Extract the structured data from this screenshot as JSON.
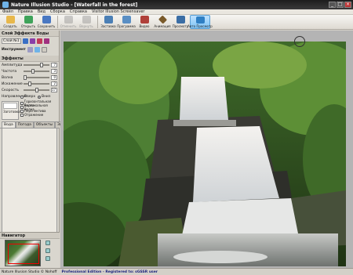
{
  "window": {
    "title": "Nature Illusion Studio - [Waterfall in the forest]"
  },
  "menu": [
    "Файл",
    "Правка",
    "Вид",
    "Сборка",
    "Справка",
    "Visitor Illusion Screensaver"
  ],
  "toolbar": {
    "buttons": [
      {
        "label": "Создать",
        "icon": "new-icon",
        "color": "#e8b84b",
        "state": "normal"
      },
      {
        "label": "Открыть",
        "icon": "open-icon",
        "color": "#3fa35a",
        "state": "normal"
      },
      {
        "label": "Сохранить",
        "icon": "save-icon",
        "color": "#4a78c2",
        "state": "normal"
      },
      {
        "label": "Отменить",
        "icon": "undo-icon",
        "color": "#777777",
        "state": "disabled"
      },
      {
        "label": "Вернуть",
        "icon": "redo-icon",
        "color": "#777777",
        "state": "disabled"
      },
      {
        "label": "Заставка",
        "icon": "screensaver-icon",
        "color": "#4b7fb5",
        "state": "normal"
      },
      {
        "label": "Программа",
        "icon": "program-icon",
        "color": "#5a8fc4",
        "state": "normal"
      },
      {
        "label": "Видео",
        "icon": "video-icon",
        "color": "#b0403a",
        "state": "normal"
      },
      {
        "label": "Анимация",
        "icon": "animation-icon",
        "color": "#7a5a2a",
        "state": "normal"
      },
      {
        "label": "Просмотр",
        "icon": "preview-icon",
        "color": "#3b6ea5",
        "state": "normal"
      },
      {
        "label": "Авто Просмотр",
        "icon": "auto-preview-icon",
        "color": "#2f7fc4",
        "state": "active"
      }
    ]
  },
  "left": {
    "water_section": "Слой Эффекта Воды",
    "layer_tab_label": "Слой №1",
    "tool_label": "Инструмент",
    "effects_title": "Эффекты",
    "params": [
      {
        "label": "Амплитуда",
        "value": "7",
        "level": 0.7
      },
      {
        "label": "Частота",
        "value": "3",
        "level": 0.35
      },
      {
        "label": "Волна",
        "value": "0",
        "level": 0.05
      },
      {
        "label": "Искажение",
        "value": "2",
        "level": 0.25
      },
      {
        "label": "Скорость",
        "value": "17",
        "level": 0.5
      }
    ],
    "direction_label": "Направление",
    "direction_options": [
      "Вверх",
      "Вниз"
    ],
    "direction_selected": "Вниз",
    "lag_label": "Заготовка",
    "lag_checks": [
      {
        "label": "Горизонтальная Волна",
        "checked": false
      },
      {
        "label": "Вертикальная Волна",
        "checked": false
      },
      {
        "label": "Перспектива",
        "checked": false
      },
      {
        "label": "Отражение",
        "checked": false
      }
    ],
    "bottom_tabs": [
      "Вода",
      "Погода",
      "Объекты",
      "Звук"
    ],
    "bottom_tab_active": "Вода",
    "navigator_title": "Навигатор"
  },
  "status": {
    "left": "Nature Illusion Studio © Nohoff",
    "edition": "Professional Edition - Registered to: sGSSR user"
  }
}
